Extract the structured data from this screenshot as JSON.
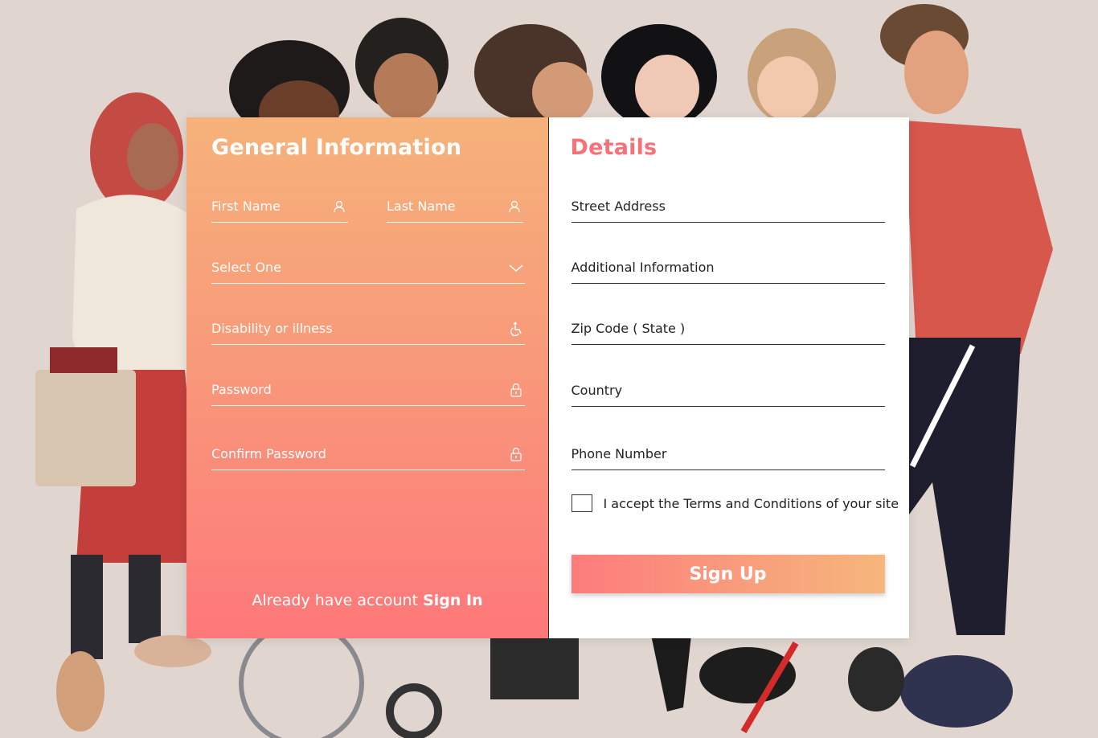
{
  "general": {
    "title": "General Information",
    "first_name": "First Name",
    "last_name": "Last Name",
    "select": "Select One",
    "disability": "Disability or illness",
    "password": "Password",
    "confirm_password": "Confirm Password",
    "already": "Already have account",
    "sign_in": "Sign In"
  },
  "details": {
    "title": "Details",
    "street": "Street Address",
    "additional": "Additional Information",
    "zip": "Zip Code ( State )",
    "country": "Country",
    "phone": "Phone Number",
    "terms": "I accept the Terms and Conditions of your site",
    "sign_up": "Sign Up"
  },
  "colors": {
    "accent": "#f8707a",
    "gradient_top": "#f6b27a",
    "gradient_bottom": "#fe787a",
    "background": "#e0d5cf"
  },
  "icons": {
    "first_name": "user-icon",
    "last_name": "user-icon",
    "select": "chevron-down-icon",
    "disability": "wheelchair-icon",
    "password": "lock-icon",
    "confirm_password": "lock-icon"
  }
}
